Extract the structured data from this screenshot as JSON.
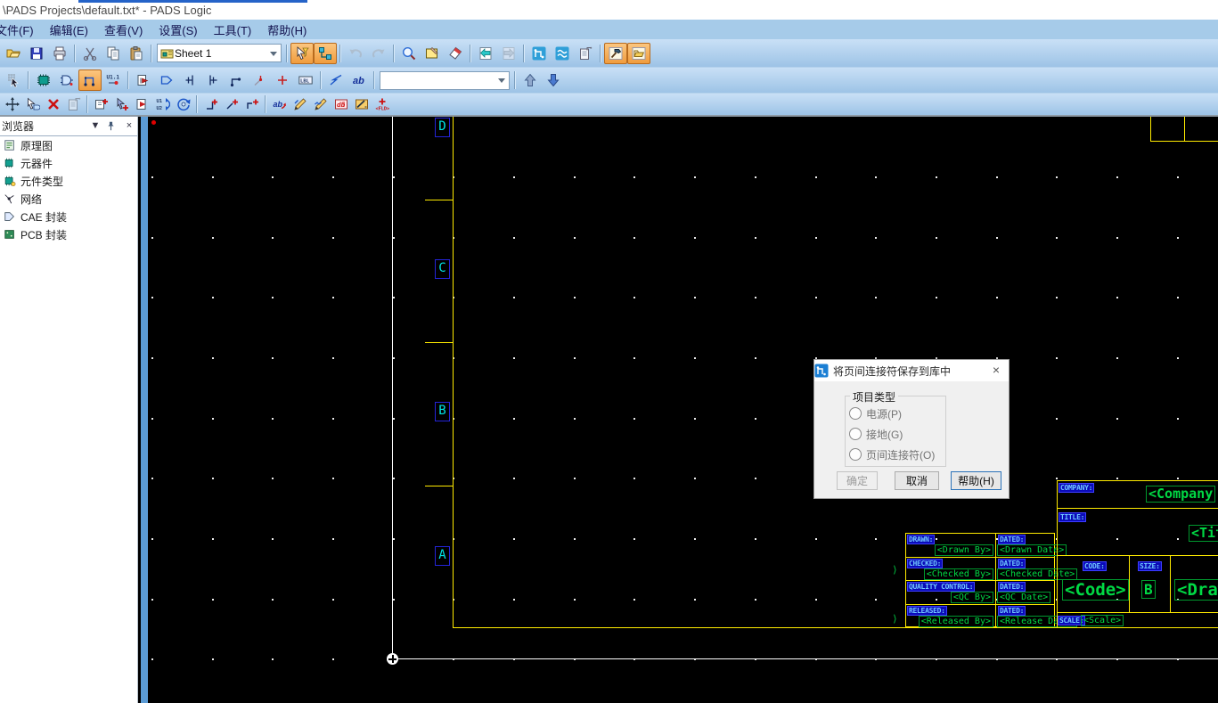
{
  "window": {
    "title": "\\PADS Projects\\default.txt* - PADS Logic"
  },
  "menu": [
    "文件(F)",
    "编辑(E)",
    "查看(V)",
    "设置(S)",
    "工具(T)",
    "帮助(H)"
  ],
  "toolbar1": [
    {
      "name": "open-file-button",
      "kind": "folder"
    },
    {
      "name": "save-file-button",
      "kind": "floppy"
    },
    {
      "name": "print-button",
      "kind": "printer"
    },
    {
      "sep": true
    },
    {
      "name": "cut-button",
      "kind": "scissors"
    },
    {
      "name": "copy-button",
      "kind": "copy"
    },
    {
      "name": "paste-button",
      "kind": "paste"
    },
    {
      "sep": true
    },
    {
      "combo": "sheet-selector",
      "value": "Sheet 1",
      "icon": "sheet",
      "width": 140
    },
    {
      "sep": true
    },
    {
      "name": "selection-mode-button",
      "kind": "cursor",
      "sel": true
    },
    {
      "name": "connection-mode-button",
      "kind": "route",
      "sel": true
    },
    {
      "sep": true
    },
    {
      "name": "undo-button",
      "kind": "undo",
      "dis": true
    },
    {
      "name": "redo-button",
      "kind": "redo",
      "dis": true
    },
    {
      "sep": true
    },
    {
      "name": "zoom-tool-button",
      "kind": "zoom"
    },
    {
      "name": "sheet-frame-button",
      "kind": "frame"
    },
    {
      "name": "redraw-button",
      "kind": "brush"
    },
    {
      "sep": true
    },
    {
      "name": "previous-sheet-button",
      "kind": "backpage"
    },
    {
      "name": "next-sheet-button",
      "kind": "fwdpage",
      "dis": true
    },
    {
      "sep": true
    },
    {
      "name": "add-connector-button",
      "kind": "jroute"
    },
    {
      "name": "bus-tool-button",
      "kind": "waves"
    },
    {
      "name": "part-properties-button",
      "kind": "propdoc"
    },
    {
      "sep": true
    },
    {
      "name": "schematic-editor-button",
      "kind": "hammer",
      "sel": true
    },
    {
      "name": "library-manager-button",
      "kind": "folderboard",
      "sel": true
    }
  ],
  "toolbar2": [
    {
      "name": "selection-filter-button",
      "kind": "gridptr"
    },
    {
      "sep": true
    },
    {
      "name": "add-part-button",
      "kind": "chip"
    },
    {
      "name": "add-gate-button",
      "kind": "gateD"
    },
    {
      "name": "add-wire-button",
      "kind": "wiretool",
      "sel": true
    },
    {
      "name": "gate-number-button",
      "kind": "u11"
    },
    {
      "sep": true
    },
    {
      "name": "part-editor-button",
      "kind": "partbox"
    },
    {
      "name": "gate-symbol-button",
      "kind": "gateshape"
    },
    {
      "name": "pin-left-button",
      "kind": "pinL"
    },
    {
      "name": "pin-right-button",
      "kind": "pinR"
    },
    {
      "name": "wire-corner-button",
      "kind": "wcorner"
    },
    {
      "name": "wire-split-button",
      "kind": "wred"
    },
    {
      "name": "connection-point-button",
      "kind": "pluspin"
    },
    {
      "name": "label-tool-button",
      "kind": "lbl"
    },
    {
      "sep": true
    },
    {
      "name": "freehand-line-button",
      "kind": "zig"
    },
    {
      "name": "text-tool-button",
      "kind": "ab"
    },
    {
      "sep": true
    },
    {
      "combo": "part-search",
      "value": "",
      "width": 146
    },
    {
      "sep": true
    },
    {
      "name": "push-level-button",
      "kind": "arrup"
    },
    {
      "name": "pop-level-button",
      "kind": "arrdown"
    }
  ],
  "toolbar3": [
    {
      "name": "move-button",
      "kind": "move"
    },
    {
      "name": "copy-object-button",
      "kind": "ptrcopy"
    },
    {
      "name": "delete-button",
      "kind": "delx"
    },
    {
      "name": "object-properties-button",
      "kind": "propdoc",
      "dis": true
    },
    {
      "sep": true
    },
    {
      "name": "add-new-part-button",
      "kind": "addboard"
    },
    {
      "name": "duplicate-button",
      "kind": "addptr"
    },
    {
      "name": "add-flag-button",
      "kind": "flagboard"
    },
    {
      "name": "swap-gates-button",
      "kind": "uswap"
    },
    {
      "name": "rotate-button",
      "kind": "rotategate"
    },
    {
      "sep": true
    },
    {
      "name": "add-pin-1-button",
      "kind": "wplusA"
    },
    {
      "name": "add-pin-2-button",
      "kind": "wplusB"
    },
    {
      "name": "add-pin-3-button",
      "kind": "wplusC"
    },
    {
      "sep": true
    },
    {
      "name": "attribute-text-button",
      "kind": "qab"
    },
    {
      "name": "edit-wire-1-button",
      "kind": "pen1"
    },
    {
      "name": "edit-wire-2-button",
      "kind": "pen2"
    },
    {
      "name": "database-button",
      "kind": "dbbox"
    },
    {
      "name": "measure-button",
      "kind": "rulerpen"
    },
    {
      "name": "field-label-button",
      "kind": "fld"
    }
  ],
  "panel": {
    "title": "浏览器",
    "items": [
      {
        "label": "原理图",
        "icon": "schematic-icon",
        "kind": "schematic"
      },
      {
        "label": "元器件",
        "icon": "component-icon",
        "kind": "component"
      },
      {
        "label": "元件类型",
        "icon": "part-type-icon",
        "kind": "parttype"
      },
      {
        "label": "网络",
        "icon": "net-icon",
        "kind": "net"
      },
      {
        "label": "CAE 封装",
        "icon": "cae-decal-icon",
        "kind": "cae"
      },
      {
        "label": "PCB 封装",
        "icon": "pcb-decal-icon",
        "kind": "pcb"
      }
    ]
  },
  "canvas": {
    "zone_letters": [
      "D",
      "C",
      "B",
      "A"
    ],
    "fragments": [
      "⟩",
      "⟩"
    ],
    "titleblock": {
      "rows": [
        {
          "label": "DRAWN:",
          "value": "<Drawn By>",
          "dated": "DATED:",
          "dvalue": "<Drawn Date>"
        },
        {
          "label": "CHECKED:",
          "value": "<Checked By>",
          "dated": "DATED:",
          "dvalue": "<Checked Date>"
        },
        {
          "label": "QUALITY CONTROL:",
          "value": "<QC By>",
          "dated": "DATED:",
          "dvalue": "<QC Date>"
        },
        {
          "label": "RELEASED:",
          "value": "<Released By>",
          "dated": "DATED:",
          "dvalue": "<Release Date>"
        }
      ],
      "company_label": "COMPANY:",
      "company_value": "<Company",
      "title_label": "TITLE:",
      "title_value": "<Tit",
      "code_label": "CODE:",
      "code_value": "<Code>",
      "size_label": "SIZE:",
      "size_value": "B",
      "drawing_value": "<Drawi",
      "scale_label": "SCALE:",
      "scale_value": "<Scale>"
    },
    "colors": {
      "sheet_border": "#ffeb00",
      "datum_line": "#ffffff",
      "zone_letter": "#00e5e5",
      "field_label": "#6fc6ff",
      "field_value": "#00d944"
    }
  },
  "dialog": {
    "title": "将页间连接符保存到库中",
    "group_label": "项目类型",
    "radios": [
      "电源(P)",
      "接地(G)",
      "页间连接符(O)"
    ],
    "buttons": {
      "ok": "确定",
      "cancel": "取消",
      "help": "帮助(H)"
    }
  }
}
